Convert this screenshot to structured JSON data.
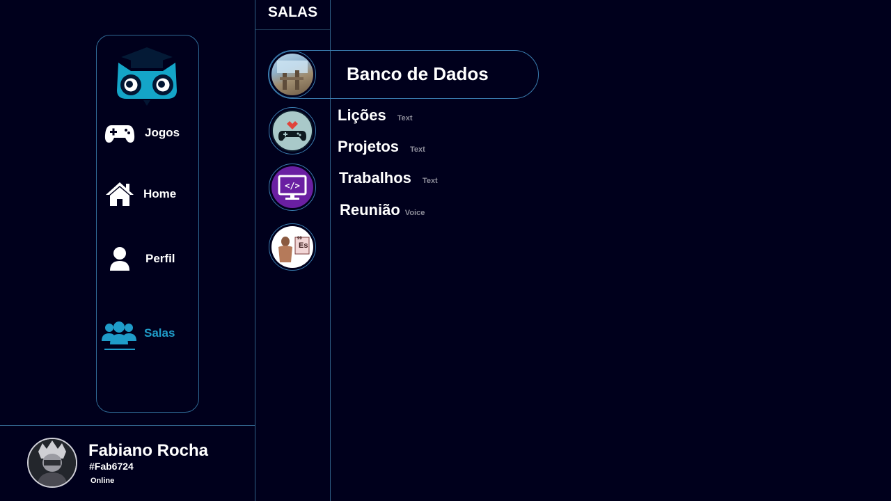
{
  "nav": {
    "items": [
      {
        "label": "Jogos",
        "icon": "gamepad-icon"
      },
      {
        "label": "Home",
        "icon": "home-icon"
      },
      {
        "label": "Perfil",
        "icon": "user-icon"
      },
      {
        "label": "Salas",
        "icon": "group-icon",
        "active": true
      }
    ],
    "active_color": "#1f9cc9"
  },
  "rooms": {
    "title": "SALAS",
    "servers": [
      {
        "icon": "landscape-icon"
      },
      {
        "icon": "gamepad-heart-icon"
      },
      {
        "icon": "code-monitor-icon"
      },
      {
        "icon": "periodic-element-icon",
        "element_symbol": "Es",
        "element_number": "99"
      }
    ],
    "selected_server": {
      "name": "Banco de Dados"
    },
    "channels": [
      {
        "name": "Lições",
        "type": "Text"
      },
      {
        "name": "Projetos",
        "type": "Text"
      },
      {
        "name": "Trabalhos",
        "type": "Text"
      },
      {
        "name": "Reunião",
        "type": "Voice"
      }
    ]
  },
  "user": {
    "name": "Fabiano Rocha",
    "tag": "#Fab6724",
    "status": "Online"
  },
  "colors": {
    "background": "#00001c",
    "border": "#2f6a95",
    "accent": "#1f9cc9",
    "muted_text": "#8d8d9a"
  }
}
